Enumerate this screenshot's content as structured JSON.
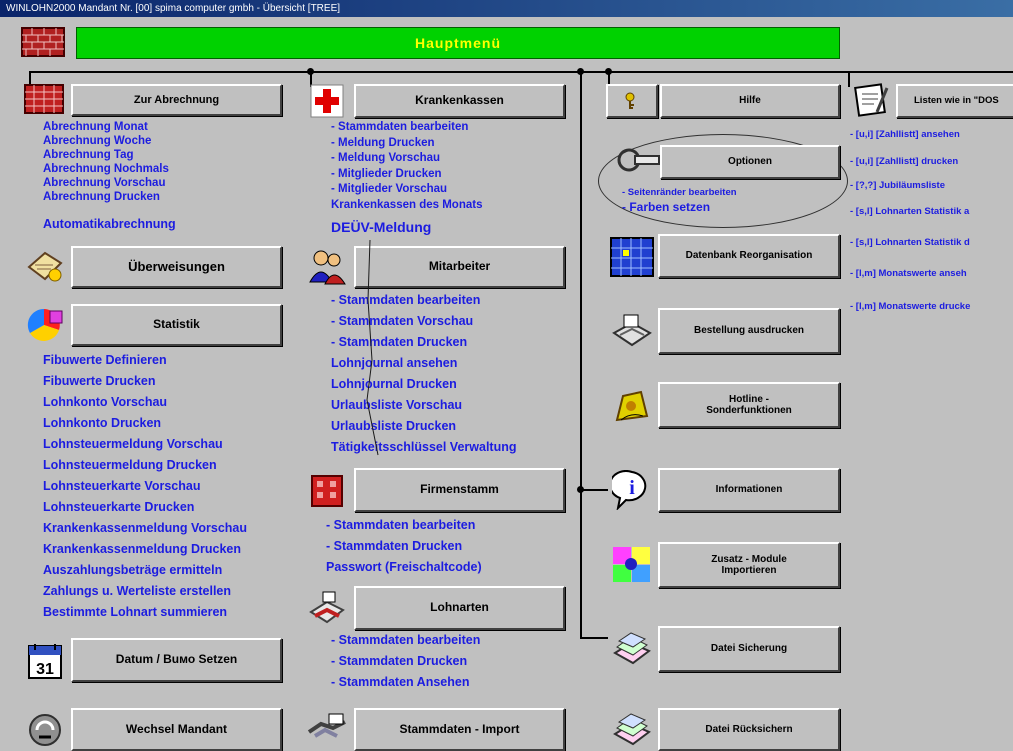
{
  "window": {
    "title": "WINLOHN2000 Mandant Nr. [00]    spima computer gmbh - Übersicht [TREE]"
  },
  "header": {
    "title": "Hauptmenü"
  },
  "col1": {
    "abrechnung": {
      "label": "Zur Abrechnung",
      "items": [
        "Abrechnung Monat",
        "Abrechnung Woche",
        "Abrechnung Tag",
        "Abrechnung Nochmals",
        "Abrechnung Vorschau",
        "Abrechnung Drucken"
      ],
      "extra": "Automatikabrechnung"
    },
    "ueberweisungen": {
      "label": "Überweisungen"
    },
    "statistik": {
      "label": "Statistik",
      "items": [
        "Fibuwerte Definieren",
        "Fibuwerte Drucken",
        "Lohnkonto Vorschau",
        "Lohnkonto Drucken",
        "Lohnsteuermeldung Vorschau",
        "Lohnsteuermeldung Drucken",
        "Lohnsteuerkarte Vorschau",
        "Lohnsteuerkarte Drucken",
        "Krankenkassenmeldung Vorschau",
        "Krankenkassenmeldung Drucken",
        "Auszahlungsbeträge ermitteln",
        "Zahlungs u. Werteliste erstellen",
        "Bestimmte Lohnart summieren"
      ]
    },
    "datum": {
      "label": "Datum / Buмо Setzen"
    },
    "wechsel": {
      "label": "Wechsel Mandant"
    }
  },
  "col2": {
    "krankenkassen": {
      "label": "Krankenkassen",
      "items": [
        "- Stammdaten bearbeiten",
        "- Meldung Drucken",
        "- Meldung Vorschau",
        "- Mitglieder Drucken",
        "- Mitglieder Vorschau",
        "Krankenkassen des Monats"
      ],
      "extra": "DEÜV-Meldung"
    },
    "mitarbeiter": {
      "label": "Mitarbeiter",
      "items": [
        "- Stammdaten bearbeiten",
        "- Stammdaten Vorschau",
        "- Stammdaten Drucken",
        "Lohnjournal ansehen",
        "Lohnjournal Drucken",
        "Urlaubsliste Vorschau",
        "Urlaubsliste Drucken",
        "Tätigkeitsschlüssel Verwaltung"
      ]
    },
    "firmenstamm": {
      "label": "Firmenstamm",
      "items": [
        "- Stammdaten bearbeiten",
        "- Stammdaten Drucken",
        "Passwort (Freischaltcode)"
      ]
    },
    "lohnarten": {
      "label": "Lohnarten",
      "items": [
        "- Stammdaten bearbeiten",
        "- Stammdaten Drucken",
        "- Stammdaten Ansehen"
      ]
    },
    "import": {
      "label": "Stammdaten - Import"
    }
  },
  "col3": {
    "hilfe": {
      "label": "Hilfe"
    },
    "optionen": {
      "label": "Optionen",
      "items": [
        "- Seitenränder bearbeiten",
        "- Farben setzen"
      ]
    },
    "datenbank": {
      "label": "Datenbank Reorganisation"
    },
    "bestellung": {
      "label": "Bestellung ausdrucken"
    },
    "hotline": {
      "label": "Hotline -\nSonderfunktionen"
    },
    "informationen": {
      "label": "Informationen"
    },
    "zusatz": {
      "label": "Zusatz - Module\nImportieren"
    },
    "sicherung": {
      "label": "Datei Sicherung"
    },
    "ruecksichern": {
      "label": "Datei Rücksichern"
    }
  },
  "col4": {
    "listen": {
      "label": "Listen wie in \"DOS"
    },
    "items": [
      "- [u,i] [Zahllistt] ansehen",
      "- [u,i] [Zahllistt] drucken",
      "- [?,?] Jubiläumsliste",
      "- [s,l] Lohnarten Statistik a",
      "- [s,l] Lohnarten Statistik d",
      "- [l,m] Monatswerte anseh",
      "- [l,m] Monatswerte drucke"
    ]
  },
  "colors": {
    "link": "#1c1ce0",
    "header_green": "#00d200",
    "window_bg": "#c0c0c0",
    "titlebar": "#0a246a"
  }
}
